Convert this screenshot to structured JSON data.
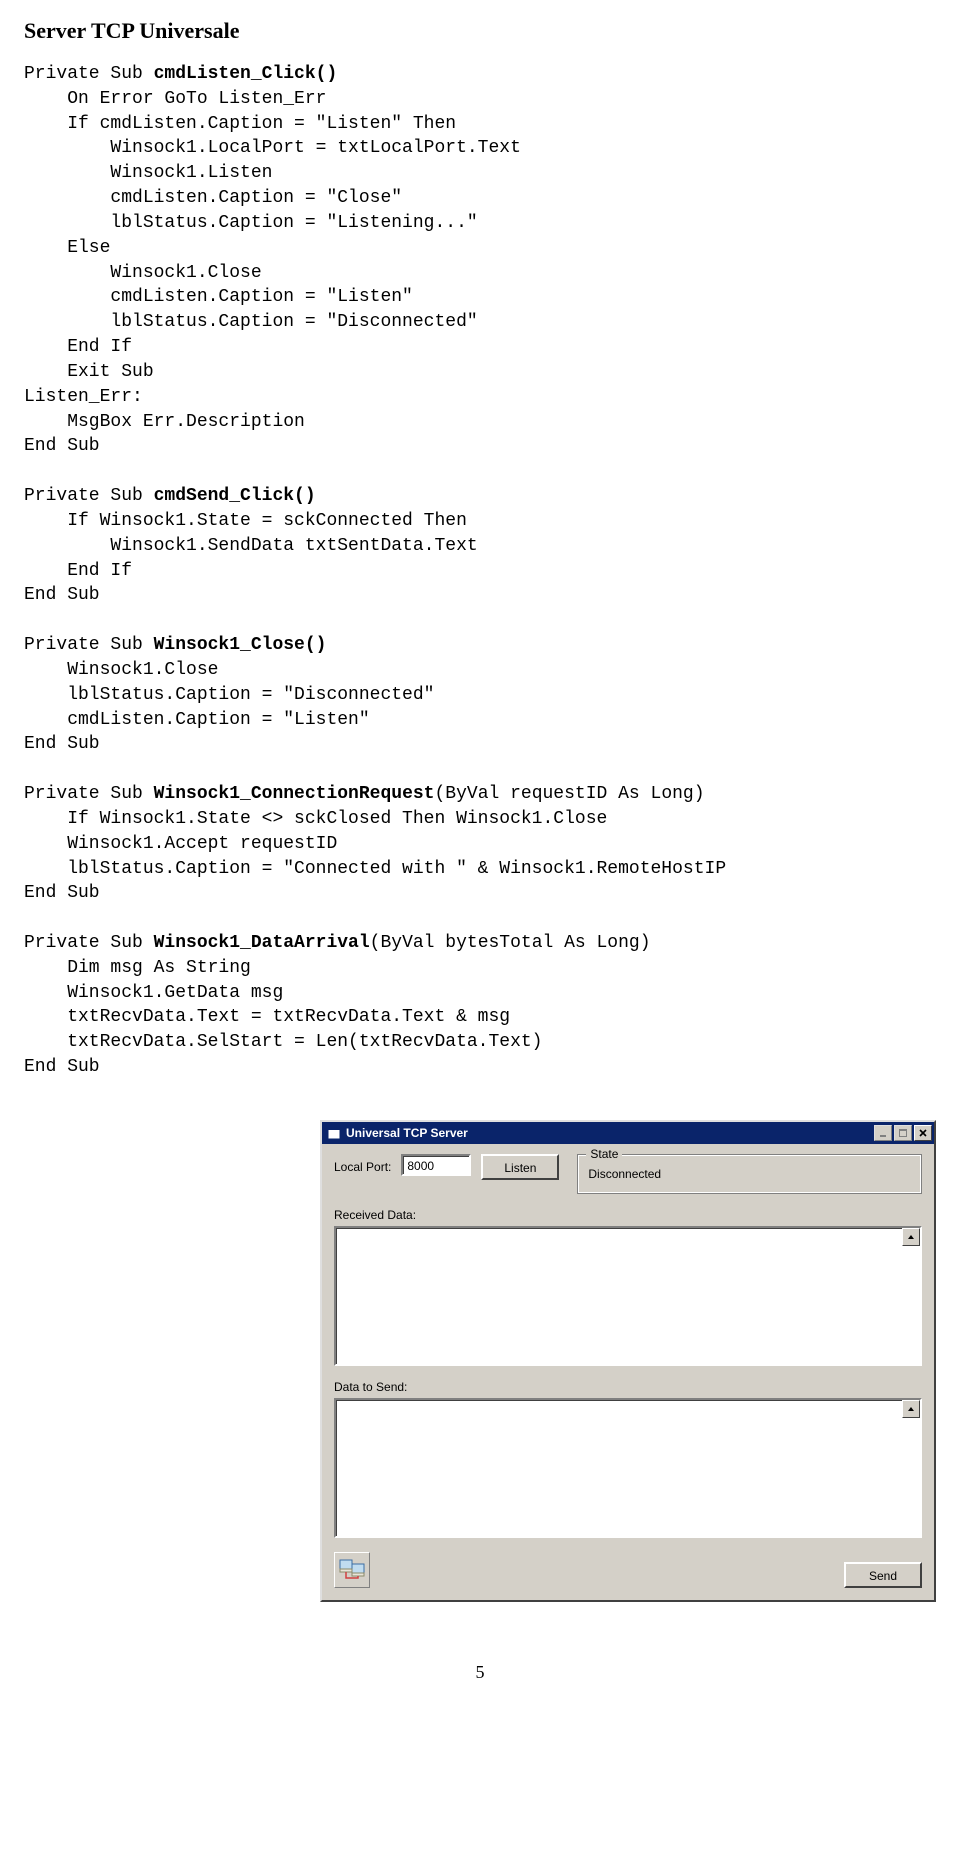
{
  "doc": {
    "section_title": "Server TCP Universale",
    "page_number": "5",
    "code_lines": [
      {
        "t": "Private Sub ",
        "b": "cmdListen_Click()"
      },
      {
        "t": "    On Error GoTo Listen_Err"
      },
      {
        "t": "    If cmdListen.Caption = \"Listen\" Then"
      },
      {
        "t": "        Winsock1.LocalPort = txtLocalPort.Text"
      },
      {
        "t": "        Winsock1.Listen"
      },
      {
        "t": "        cmdListen.Caption = \"Close\""
      },
      {
        "t": "        lblStatus.Caption = \"Listening...\""
      },
      {
        "t": "    Else"
      },
      {
        "t": "        Winsock1.Close"
      },
      {
        "t": "        cmdListen.Caption = \"Listen\""
      },
      {
        "t": "        lblStatus.Caption = \"Disconnected\""
      },
      {
        "t": "    End If"
      },
      {
        "t": "    Exit Sub"
      },
      {
        "t": "Listen_Err:"
      },
      {
        "t": "    MsgBox Err.Description"
      },
      {
        "t": "End Sub"
      },
      {
        "t": ""
      },
      {
        "t": "Private Sub ",
        "b": "cmdSend_Click()"
      },
      {
        "t": "    If Winsock1.State = sckConnected Then"
      },
      {
        "t": "        Winsock1.SendData txtSentData.Text"
      },
      {
        "t": "    End If"
      },
      {
        "t": "End Sub"
      },
      {
        "t": ""
      },
      {
        "t": "Private Sub ",
        "b": "Winsock1_Close()"
      },
      {
        "t": "    Winsock1.Close"
      },
      {
        "t": "    lblStatus.Caption = \"Disconnected\""
      },
      {
        "t": "    cmdListen.Caption = \"Listen\""
      },
      {
        "t": "End Sub"
      },
      {
        "t": ""
      },
      {
        "t": "Private Sub ",
        "b": "Winsock1_ConnectionRequest",
        "after": "(ByVal requestID As Long)"
      },
      {
        "t": "    If Winsock1.State <> sckClosed Then Winsock1.Close"
      },
      {
        "t": "    Winsock1.Accept requestID"
      },
      {
        "t": "    lblStatus.Caption = \"Connected with \" & Winsock1.RemoteHostIP"
      },
      {
        "t": "End Sub"
      },
      {
        "t": ""
      },
      {
        "t": "Private Sub ",
        "b": "Winsock1_DataArrival",
        "after": "(ByVal bytesTotal As Long)"
      },
      {
        "t": "    Dim msg As String"
      },
      {
        "t": "    Winsock1.GetData msg"
      },
      {
        "t": "    txtRecvData.Text = txtRecvData.Text & msg"
      },
      {
        "t": "    txtRecvData.SelStart = Len(txtRecvData.Text)"
      },
      {
        "t": "End Sub"
      }
    ]
  },
  "window": {
    "title": "Universal TCP Server",
    "local_port_label": "Local Port:",
    "local_port_value": "8000",
    "listen_button": "Listen",
    "state_group_label": "State",
    "state_value": "Disconnected",
    "received_label": "Received Data:",
    "send_label": "Data to Send:",
    "send_button": "Send"
  }
}
